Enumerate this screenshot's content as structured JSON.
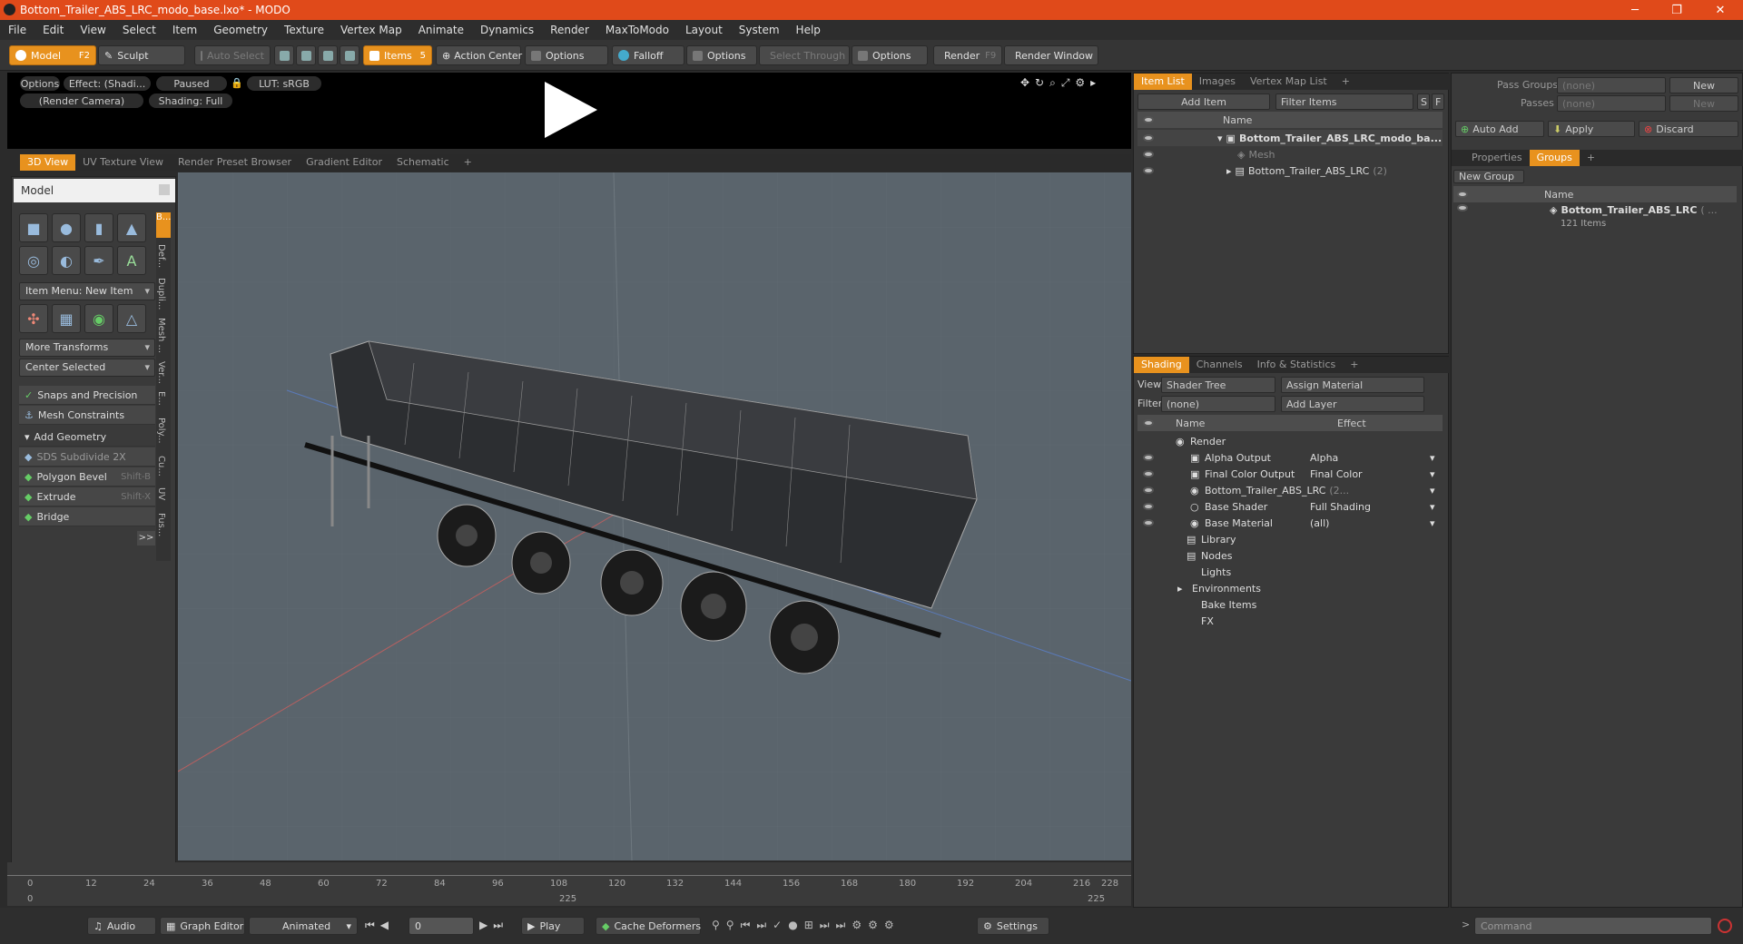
{
  "window": {
    "title": "Bottom_Trailer_ABS_LRC_modo_base.lxo* - MODO",
    "minimize": "─",
    "restore": "❐",
    "close": "✕"
  },
  "menu": [
    "File",
    "Edit",
    "View",
    "Select",
    "Item",
    "Geometry",
    "Texture",
    "Vertex Map",
    "Animate",
    "Dynamics",
    "Render",
    "MaxToModo",
    "Layout",
    "System",
    "Help"
  ],
  "toolbar": {
    "model": "Model",
    "model_hk": "F2",
    "sculpt": "Sculpt",
    "auto_select": "Auto Select",
    "items": "Items",
    "items_hk": "5",
    "action_center": "Action Center",
    "options1": "Options",
    "falloff": "Falloff",
    "options2": "Options",
    "select_through": "Select Through",
    "options3": "Options",
    "render": "Render",
    "render_hk": "F9",
    "render_window": "Render Window"
  },
  "preview": {
    "options": "Options",
    "effect": "Effect: (Shadi...",
    "paused": "Paused",
    "lut": "LUT: sRGB",
    "camera": "(Render Camera)",
    "shading": "Shading: Full"
  },
  "viewport_tabs": [
    "3D View",
    "UV Texture View",
    "Render Preset Browser",
    "Gradient Editor",
    "Schematic"
  ],
  "left": {
    "title": "Model",
    "item_menu": "Item Menu: New Item",
    "more_transforms": "More Transforms",
    "center_selected": "Center Selected",
    "snaps": "Snaps and Precision",
    "mesh_constraints": "Mesh Constraints",
    "add_geometry": "Add Geometry",
    "sds": "SDS Subdivide 2X",
    "polygon_bevel": "Polygon Bevel",
    "polygon_bevel_hk": "Shift-B",
    "extrude": "Extrude",
    "extrude_hk": "Shift-X",
    "bridge": "Bridge",
    "more": ">>",
    "vtabs": [
      "B...",
      "Def...",
      "Dupli...",
      "Mesh ...",
      "Ver...",
      "E...",
      "Poly...",
      "Cu...",
      "UV",
      "Fus..."
    ]
  },
  "timeline": {
    "ticks": [
      "0",
      "12",
      "24",
      "36",
      "48",
      "60",
      "72",
      "84",
      "96",
      "108",
      "120",
      "132",
      "144",
      "156",
      "168",
      "180",
      "192",
      "204",
      "216"
    ],
    "end": "228",
    "start_val": "0",
    "mid": "225",
    "end_val": "225"
  },
  "bottom": {
    "audio": "Audio",
    "graph_editor": "Graph Editor",
    "animated": "Animated",
    "frame": "0",
    "play": "Play",
    "cache": "Cache Deformers",
    "settings": "Settings",
    "command": "Command"
  },
  "item_list": {
    "tabs": [
      "Item List",
      "Images",
      "Vertex Map List"
    ],
    "add_item": "Add Item",
    "filter": "Filter Items",
    "s": "S",
    "f": "F",
    "col_name": "Name",
    "rows": [
      "Bottom_Trailer_ABS_LRC_modo_ba...",
      "Mesh",
      "Bottom_Trailer_ABS_LRC"
    ],
    "row2_count": "(2)"
  },
  "shading": {
    "tabs": [
      "Shading",
      "Channels",
      "Info & Statistics"
    ],
    "view_label": "View",
    "view": "Shader Tree",
    "assign": "Assign Material",
    "filter_label": "Filter",
    "filter": "(none)",
    "add_layer": "Add Layer",
    "col_name": "Name",
    "col_effect": "Effect",
    "rows": [
      {
        "name": "Render",
        "effect": ""
      },
      {
        "name": "Alpha Output",
        "effect": "Alpha"
      },
      {
        "name": "Final Color Output",
        "effect": "Final Color"
      },
      {
        "name": "Bottom_Trailer_ABS_LRC",
        "effect": "",
        "count": "(2..."
      },
      {
        "name": "Base Shader",
        "effect": "Full Shading"
      },
      {
        "name": "Base Material",
        "effect": "(all)"
      },
      {
        "name": "Library",
        "effect": ""
      },
      {
        "name": "Nodes",
        "effect": ""
      },
      {
        "name": "Lights",
        "effect": ""
      },
      {
        "name": "Environments",
        "effect": ""
      },
      {
        "name": "Bake Items",
        "effect": ""
      },
      {
        "name": "FX",
        "effect": ""
      }
    ]
  },
  "groups": {
    "pass_groups": "Pass Groups",
    "passes": "Passes",
    "none1": "(none)",
    "none2": "(none)",
    "new1": "New",
    "new2": "New",
    "auto_add": "Auto Add",
    "apply": "Apply",
    "discard": "Discard",
    "tabs": [
      "Properties",
      "Groups"
    ],
    "new_group": "New Group",
    "col_name": "Name",
    "group_name": "Bottom_Trailer_ABS_LRC",
    "group_suffix": "( ...",
    "group_items": "121 Items"
  }
}
